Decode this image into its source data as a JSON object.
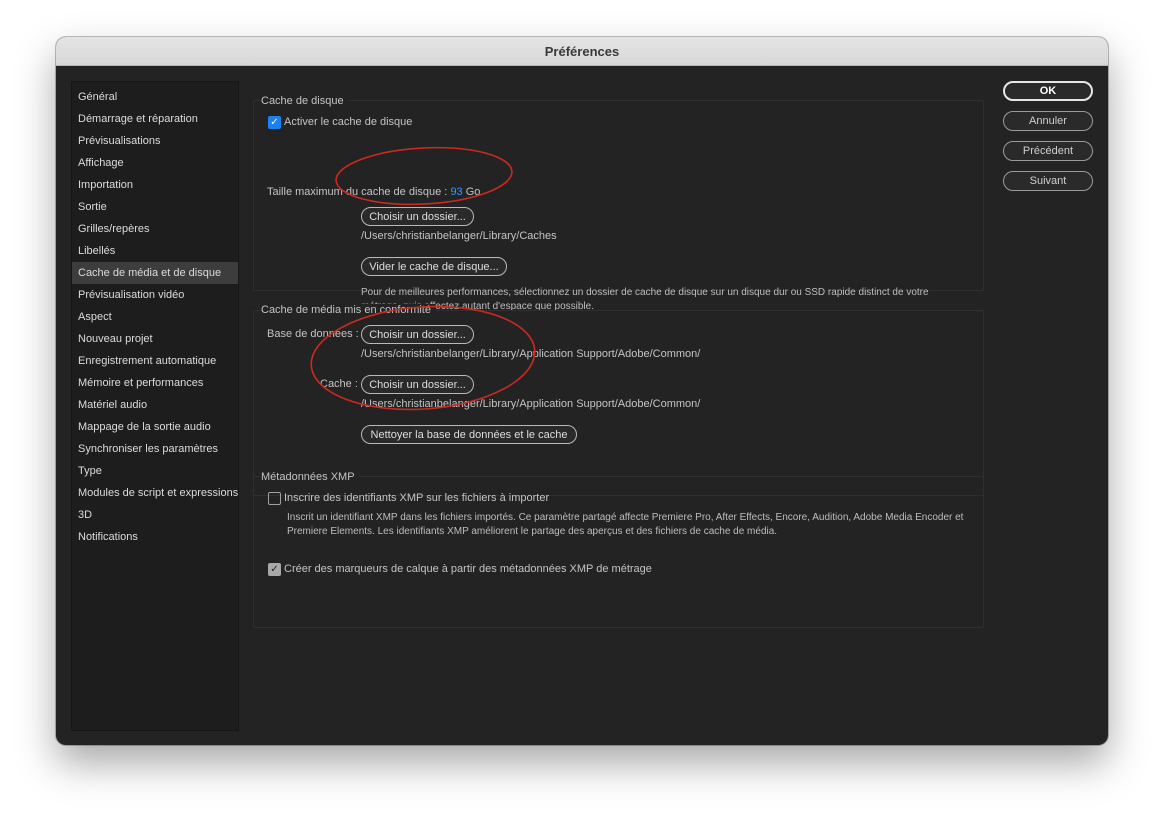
{
  "window": {
    "title": "Préférences"
  },
  "sidebar": {
    "items": [
      "Général",
      "Démarrage et réparation",
      "Prévisualisations",
      "Affichage",
      "Importation",
      "Sortie",
      "Grilles/repères",
      "Libellés",
      "Cache de média et de disque",
      "Prévisualisation vidéo",
      "Aspect",
      "Nouveau projet",
      "Enregistrement automatique",
      "Mémoire et performances",
      "Matériel audio",
      "Mappage de la sortie audio",
      "Synchroniser les paramètres",
      "Type",
      "Modules de script et expressions",
      "3D",
      "Notifications"
    ],
    "selected": "Cache de média et de disque"
  },
  "disk_cache": {
    "title": "Cache de disque",
    "enable_label": "Activer le cache de disque",
    "enable_checked": true,
    "max_size_label": "Taille maximum du cache de disque :",
    "max_size_value": "93",
    "max_size_unit": "Go",
    "choose_folder_label": "Choisir un dossier...",
    "path": "/Users/christianbelanger/Library/Caches",
    "empty_cache_label": "Vider le cache de disque...",
    "note": "Pour de meilleures performances, sélectionnez un dossier de cache de disque sur un disque dur ou SSD rapide distinct de votre métrage, puis affectez autant d'espace que possible."
  },
  "conformed_cache": {
    "title": "Cache de média mis en conformité",
    "database_label": "Base de données :",
    "database_button": "Choisir un dossier...",
    "database_path": "/Users/christianbelanger/Library/Application Support/Adobe/Common/",
    "cache_label": "Cache :",
    "cache_button": "Choisir un dossier...",
    "cache_path": "/Users/christianbelanger/Library/Application Support/Adobe/Common/",
    "clean_label": "Nettoyer la base de données et le cache"
  },
  "xmp": {
    "title": "Métadonnées XMP",
    "write_ids_label": "Inscrire des identifiants XMP sur les fichiers à importer",
    "write_ids_checked": false,
    "note": "Inscrit un identifiant XMP dans les fichiers importés. Ce paramètre partagé affecte Premiere Pro, After Effects, Encore, Audition, Adobe Media Encoder et Premiere Elements. Les identifiants XMP améliorent le partage des aperçus et des fichiers de cache de média.",
    "markers_label": "Créer des marqueurs de calque à partir des métadonnées XMP de métrage",
    "markers_checked": true
  },
  "actions": {
    "ok": "OK",
    "cancel": "Annuler",
    "previous": "Précédent",
    "next": "Suivant"
  },
  "colors": {
    "window_bg": "#232323",
    "accent_blue": "#1a82f0",
    "annotation_red": "#cc2a1e"
  }
}
